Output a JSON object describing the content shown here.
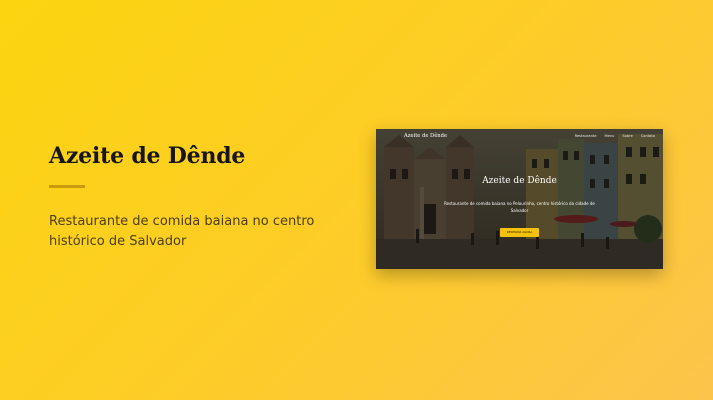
{
  "project": {
    "title": "Azeite de Dênde",
    "description": "Restaurante de comida baiana no centro histórico de Salvador"
  },
  "preview": {
    "brand": "Azeite de Dênde",
    "nav_links": [
      "Restaurante",
      "Menu",
      "Sobre",
      "Contato"
    ],
    "hero_title": "Azeite de Dênde",
    "hero_text": "Restaurante de comida baiana no Pelourinho, centro histórico da cidade de Salvador",
    "cta_label": "RESERVAR AGORA"
  },
  "colors": {
    "accent": "#fcd40f",
    "rule": "#c99a0c",
    "cta": "#f4c20d"
  }
}
